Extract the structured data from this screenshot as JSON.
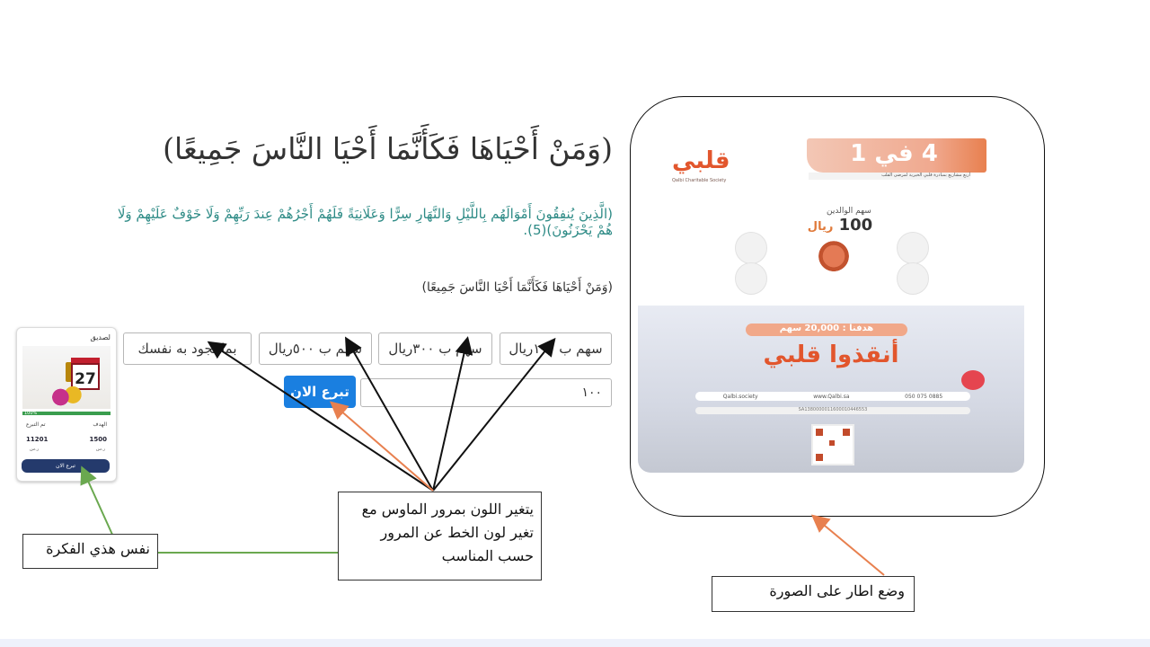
{
  "headings": {
    "main_title": "(وَمَنْ أَحْيَاهَا فَكَأَنَّمَا أَحْيَا النَّاسَ جَمِيعًا)",
    "verse": "(الَّذِينَ يُنفِقُونَ أَمْوَالَهُم بِاللَّيْلِ وَالنَّهَارِ سِرًّا وَعَلَانِيَةً فَلَهُمْ أَجْرُهُمْ عِندَ رَبِّهِمْ وَلَا خَوْفٌ عَلَيْهِمْ وَلَا هُمْ يَحْزَنُونَ)(5).",
    "small_title": "(وَمَنْ أَحْيَاهَا فَكَأَنَّمَا أَحْيَا النَّاسَ جَمِيعًا)"
  },
  "share_options": [
    {
      "label": "سهم ب ١٠٠ريال"
    },
    {
      "label": "سهم ب ٣٠٠ريال"
    },
    {
      "label": "سهم ب ٥٠٠ريال"
    },
    {
      "label": "بما تجود به نفسك"
    }
  ],
  "donation": {
    "amount_value": "١٠٠",
    "donate_label": "تبرع الان"
  },
  "card": {
    "header": "لصديق",
    "calendar_day": "27",
    "progress_label": "100%",
    "progress_value": 1.0,
    "goal_label": "الهدف",
    "donated_label": "تم التبرع",
    "goal_value": "1500",
    "donated_value": "11201",
    "currency": "ر.س",
    "button": "تبرع الان"
  },
  "annotations": {
    "main_note": "يتغير اللون بمرور الماوس مع تغير لون الخط عن المرور حسب المناسب",
    "left_note": "نفس هذي الفكرة",
    "right_note": "وضع اطار على الصورة"
  },
  "poster": {
    "logo": "قلبي",
    "logo_sub": "Qalbi Charitable Society",
    "ribbon": "4 في 1",
    "ribbon_sub": "أربع مشاريع بمبادرة قلبي الخيرية لمرضى القلب",
    "share_title": "سهم الوالدين",
    "share_price": "100",
    "share_currency": "ريال",
    "goal": "هدفنا : 20,000 سهم",
    "slogan": "أنقذوا قلبي",
    "contact_1": "Qalbi.society",
    "contact_2": "www.Qalbi.sa",
    "contact_3": "050 075 0885",
    "iban": "SA1380000011600010446553",
    "accent_color": "#e2562d"
  },
  "colors": {
    "verse_text": "#2e8b86",
    "donate_button": "#1a7fe0",
    "card_button": "#243a6c",
    "progress": "#3a9d4e",
    "arrow_orange": "#e8804f",
    "arrow_green": "#6aa84f"
  }
}
